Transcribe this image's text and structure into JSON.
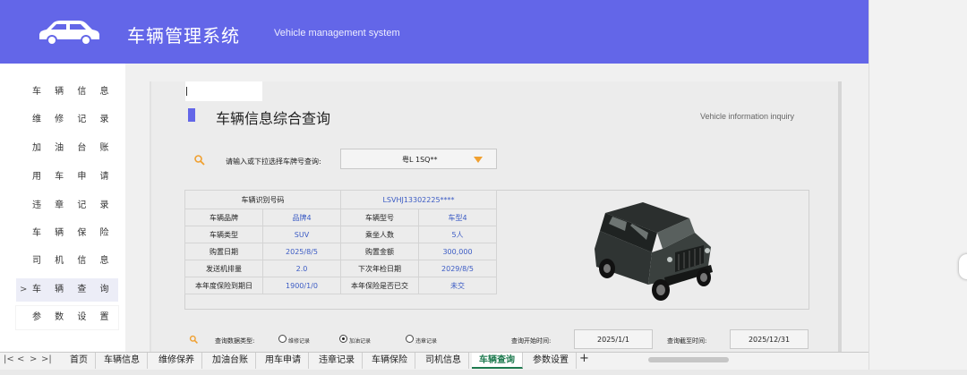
{
  "header": {
    "title": "车辆管理系统",
    "subtitle": "Vehicle management system",
    "bg_color": "#6366e8",
    "logo_icon": "car-icon"
  },
  "sidebar": {
    "items": [
      {
        "label": "车 辆 信 息"
      },
      {
        "label": "维 修 记 录"
      },
      {
        "label": "加 油 台 账"
      },
      {
        "label": "用 车 申 请"
      },
      {
        "label": "违 章 记 录"
      },
      {
        "label": "车 辆 保 险"
      },
      {
        "label": "司 机 信 息"
      },
      {
        "label": "车 辆 查 询",
        "active": true,
        "arrow": ">"
      },
      {
        "label": "参 数 设 置"
      }
    ]
  },
  "page": {
    "title": "车辆信息综合查询",
    "subtitle": "Vehicle information inquiry",
    "accent_color": "#6366e8"
  },
  "search": {
    "label": "请输入或下拉选择车牌号查询:",
    "plate_value": "粤L 1SQ**"
  },
  "info_table": {
    "vin_label": "车辆识别号码",
    "vin_value": "LSVHJ13302225****",
    "rows": [
      {
        "l1": "车辆品牌",
        "v1": "品牌4",
        "l2": "车辆型号",
        "v2": "车型4"
      },
      {
        "l1": "车辆类型",
        "v1": "SUV",
        "l2": "乘坐人数",
        "v2": "5人"
      },
      {
        "l1": "购置日期",
        "v1": "2025/8/5",
        "l2": "购置金额",
        "v2": "300,000"
      },
      {
        "l1": "发送机排量",
        "v1": "2.0",
        "l2": "下次年检日期",
        "v2": "2029/8/5"
      },
      {
        "l1": "本年度保险到期日",
        "v1": "1900/1/0",
        "l2": "本年保险是否已交",
        "v2": "未交"
      }
    ],
    "value_color": "#3b5bc4",
    "image_icon": "black-suv-image"
  },
  "query": {
    "label": "查询数据类型:",
    "options": [
      "维修记录",
      "加油记录",
      "违章记录"
    ],
    "selected_index": 1,
    "start_label": "查询开始时间:",
    "start_value": "2025/1/1",
    "end_label": "查询截至时间:",
    "end_value": "2025/12/31"
  },
  "sheet_tabs": {
    "nav": [
      "|<",
      "<",
      ">",
      ">|"
    ],
    "tabs": [
      "首页",
      "车辆信息",
      "维修保养",
      "加油台账",
      "用车申请",
      "违章记录",
      "车辆保险",
      "司机信息",
      "车辆查询",
      "参数设置"
    ],
    "active_index": 8,
    "add_label": "+",
    "active_color": "#1e7a4f"
  }
}
